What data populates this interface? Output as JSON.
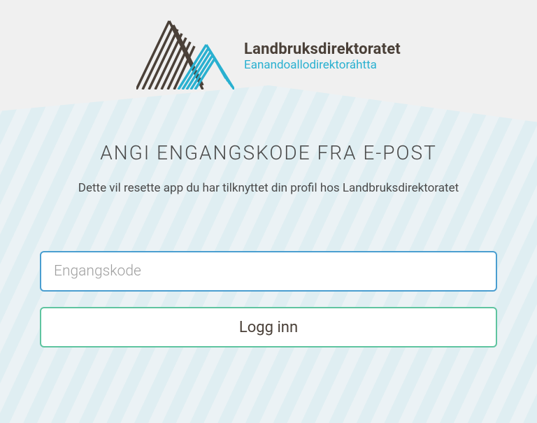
{
  "logo": {
    "title": "Landbruksdirektoratet",
    "subtitle": "Eanandoallodirektoráhtta"
  },
  "heading": "ANGI ENGANGSKODE FRA E-POST",
  "description": "Dette vil resette app du har tilknyttet din profil hos Landbruksdirektoratet",
  "form": {
    "code_placeholder": "Engangskode",
    "code_value": "",
    "login_label": "Logg inn"
  }
}
